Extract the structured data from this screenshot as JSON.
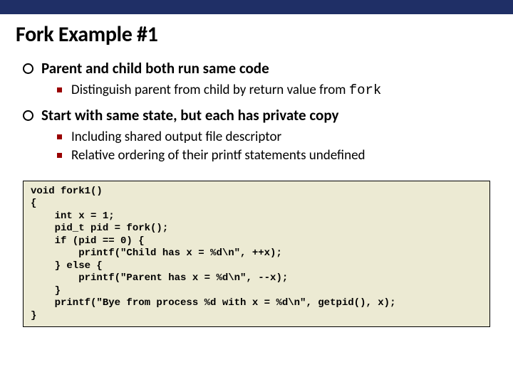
{
  "title": "Fork Example #1",
  "bullets": [
    {
      "label": "Parent and child both run same code",
      "sub": [
        {
          "pre": "Distinguish parent from child by return value from ",
          "code": "fork"
        }
      ]
    },
    {
      "label": "Start with same state, but each has private copy",
      "sub": [
        {
          "pre": "Including shared output file descriptor",
          "code": ""
        },
        {
          "pre": "Relative ordering of their printf statements undefined",
          "code": ""
        }
      ]
    }
  ],
  "code": "void fork1()\n{\n    int x = 1;\n    pid_t pid = fork();\n    if (pid == 0) {\n        printf(\"Child has x = %d\\n\", ++x);\n    } else {\n        printf(\"Parent has x = %d\\n\", --x);\n    }\n    printf(\"Bye from process %d with x = %d\\n\", getpid(), x);\n}"
}
